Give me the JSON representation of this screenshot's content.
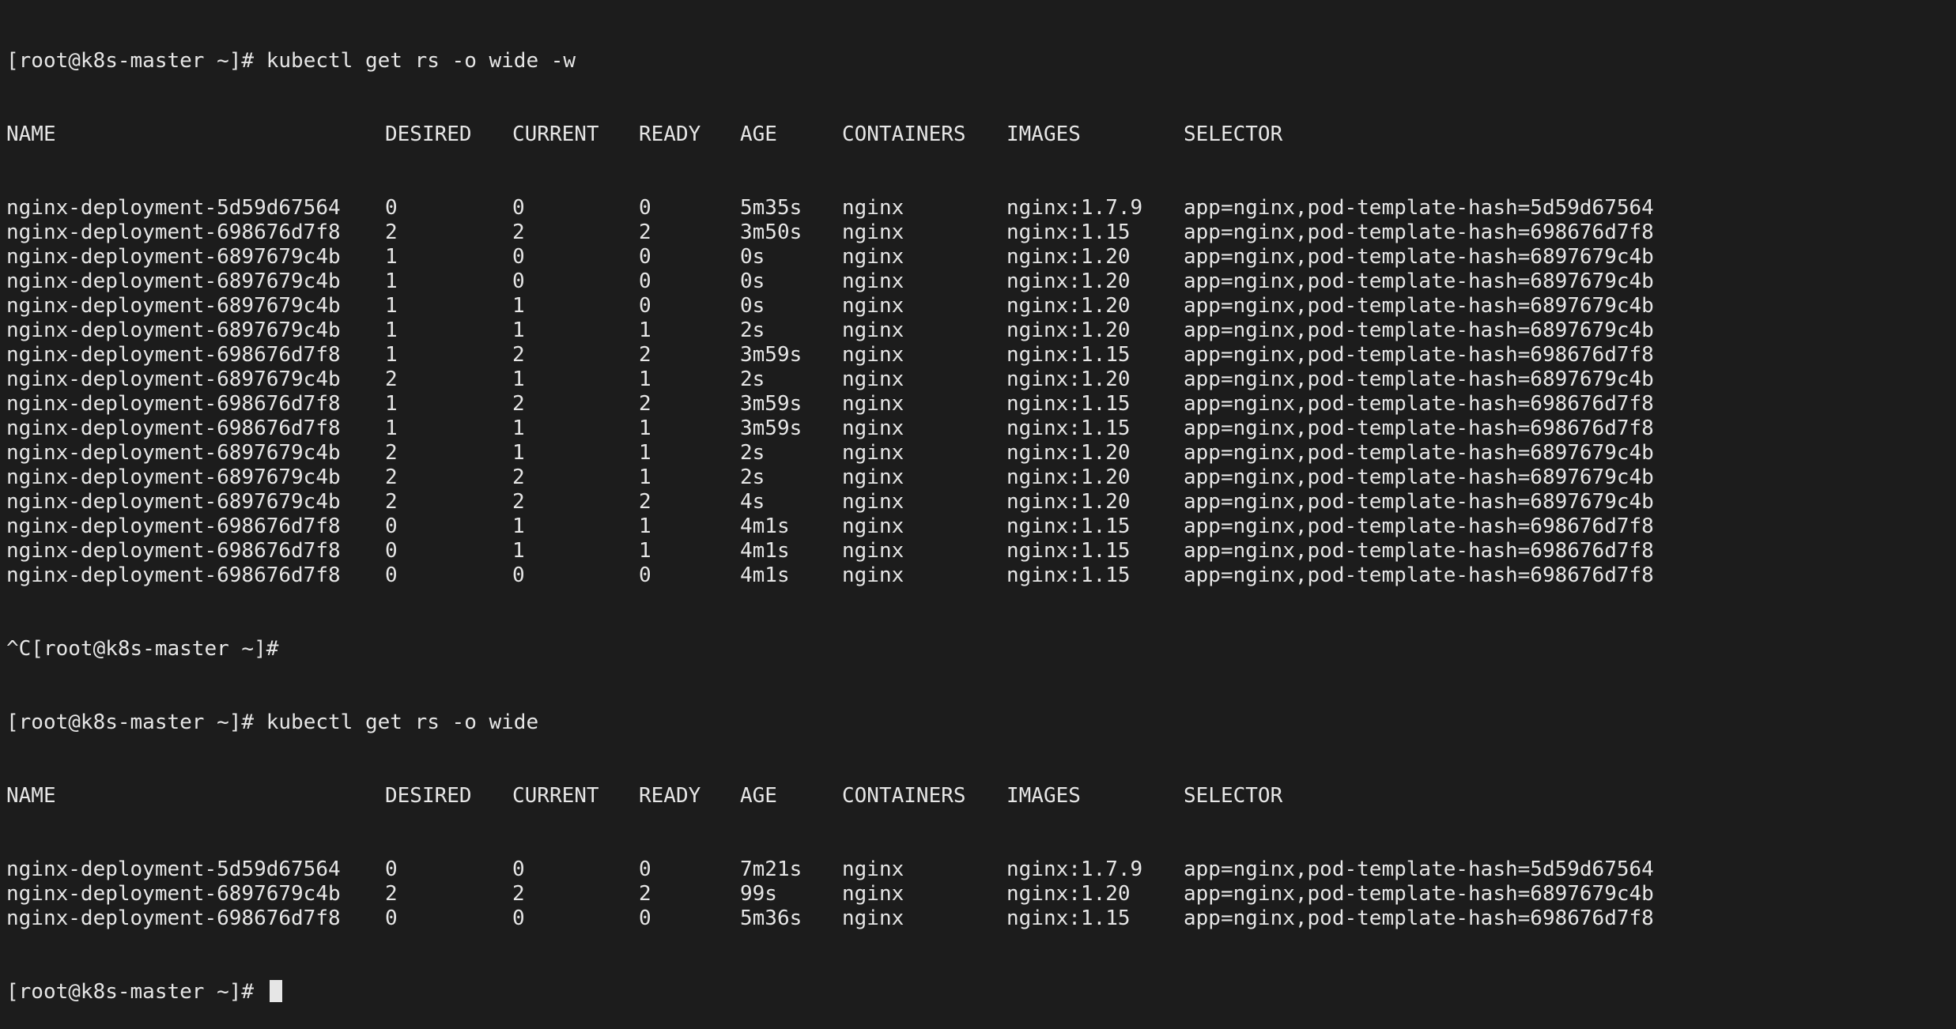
{
  "prompt": "[root@k8s-master ~]#",
  "cmd1": "kubectl get rs -o wide -w",
  "headers": [
    "NAME",
    "DESIRED",
    "CURRENT",
    "READY",
    "AGE",
    "CONTAINERS",
    "IMAGES",
    "SELECTOR"
  ],
  "watch_rows": [
    [
      "nginx-deployment-5d59d67564",
      "0",
      "0",
      "0",
      "5m35s",
      "nginx",
      "nginx:1.7.9",
      "app=nginx,pod-template-hash=5d59d67564"
    ],
    [
      "nginx-deployment-698676d7f8",
      "2",
      "2",
      "2",
      "3m50s",
      "nginx",
      "nginx:1.15",
      "app=nginx,pod-template-hash=698676d7f8"
    ],
    [
      "nginx-deployment-6897679c4b",
      "1",
      "0",
      "0",
      "0s",
      "nginx",
      "nginx:1.20",
      "app=nginx,pod-template-hash=6897679c4b"
    ],
    [
      "nginx-deployment-6897679c4b",
      "1",
      "0",
      "0",
      "0s",
      "nginx",
      "nginx:1.20",
      "app=nginx,pod-template-hash=6897679c4b"
    ],
    [
      "nginx-deployment-6897679c4b",
      "1",
      "1",
      "0",
      "0s",
      "nginx",
      "nginx:1.20",
      "app=nginx,pod-template-hash=6897679c4b"
    ],
    [
      "nginx-deployment-6897679c4b",
      "1",
      "1",
      "1",
      "2s",
      "nginx",
      "nginx:1.20",
      "app=nginx,pod-template-hash=6897679c4b"
    ],
    [
      "nginx-deployment-698676d7f8",
      "1",
      "2",
      "2",
      "3m59s",
      "nginx",
      "nginx:1.15",
      "app=nginx,pod-template-hash=698676d7f8"
    ],
    [
      "nginx-deployment-6897679c4b",
      "2",
      "1",
      "1",
      "2s",
      "nginx",
      "nginx:1.20",
      "app=nginx,pod-template-hash=6897679c4b"
    ],
    [
      "nginx-deployment-698676d7f8",
      "1",
      "2",
      "2",
      "3m59s",
      "nginx",
      "nginx:1.15",
      "app=nginx,pod-template-hash=698676d7f8"
    ],
    [
      "nginx-deployment-698676d7f8",
      "1",
      "1",
      "1",
      "3m59s",
      "nginx",
      "nginx:1.15",
      "app=nginx,pod-template-hash=698676d7f8"
    ],
    [
      "nginx-deployment-6897679c4b",
      "2",
      "1",
      "1",
      "2s",
      "nginx",
      "nginx:1.20",
      "app=nginx,pod-template-hash=6897679c4b"
    ],
    [
      "nginx-deployment-6897679c4b",
      "2",
      "2",
      "1",
      "2s",
      "nginx",
      "nginx:1.20",
      "app=nginx,pod-template-hash=6897679c4b"
    ],
    [
      "nginx-deployment-6897679c4b",
      "2",
      "2",
      "2",
      "4s",
      "nginx",
      "nginx:1.20",
      "app=nginx,pod-template-hash=6897679c4b"
    ],
    [
      "nginx-deployment-698676d7f8",
      "0",
      "1",
      "1",
      "4m1s",
      "nginx",
      "nginx:1.15",
      "app=nginx,pod-template-hash=698676d7f8"
    ],
    [
      "nginx-deployment-698676d7f8",
      "0",
      "1",
      "1",
      "4m1s",
      "nginx",
      "nginx:1.15",
      "app=nginx,pod-template-hash=698676d7f8"
    ],
    [
      "nginx-deployment-698676d7f8",
      "0",
      "0",
      "0",
      "4m1s",
      "nginx",
      "nginx:1.15",
      "app=nginx,pod-template-hash=698676d7f8"
    ]
  ],
  "interrupt_line": "^C[root@k8s-master ~]#",
  "cmd2": "kubectl get rs -o wide",
  "final_rows": [
    [
      "nginx-deployment-5d59d67564",
      "0",
      "0",
      "0",
      "7m21s",
      "nginx",
      "nginx:1.7.9",
      "app=nginx,pod-template-hash=5d59d67564"
    ],
    [
      "nginx-deployment-6897679c4b",
      "2",
      "2",
      "2",
      "99s",
      "nginx",
      "nginx:1.20",
      "app=nginx,pod-template-hash=6897679c4b"
    ],
    [
      "nginx-deployment-698676d7f8",
      "0",
      "0",
      "0",
      "5m36s",
      "nginx",
      "nginx:1.15",
      "app=nginx,pod-template-hash=698676d7f8"
    ]
  ]
}
